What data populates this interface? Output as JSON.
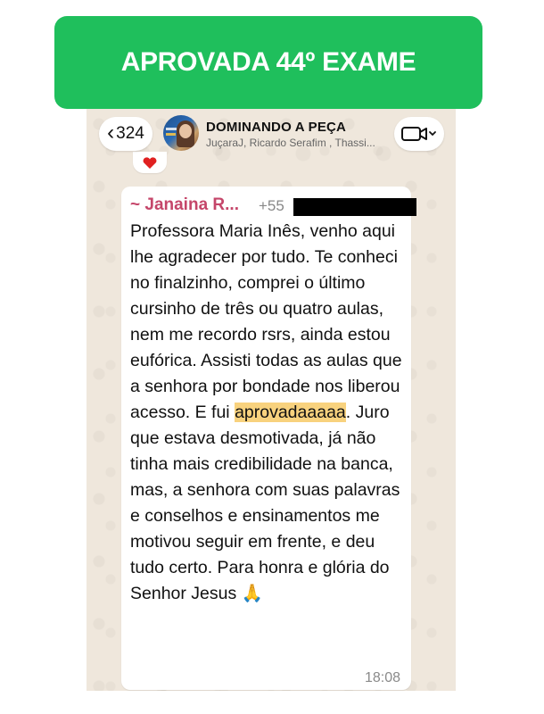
{
  "banner": {
    "text": "APROVADA 44º EXAME"
  },
  "header": {
    "back_count": "324",
    "group_title": "DOMINANDO A PEÇA",
    "group_members": "JuçaraJ, Ricardo Serafim , Thassi..."
  },
  "reaction": {
    "emoji": "heart"
  },
  "message": {
    "sender_name": "~ Janaina R...",
    "sender_phone": "+55",
    "text_before": "Professora Maria Inês, venho aqui lhe agradecer por tudo. Te conheci no finalzinho, comprei o último cursinho de três ou quatro aulas, nem me recordo rsrs, ainda estou eufórica. Assisti todas as aulas que a senhora por bondade nos liberou acesso. E fui ",
    "text_highlight": "aprovadaaaaa",
    "text_after": ". Juro que estava desmotivada, já não tinha mais credibilidade na banca, mas, a senhora com suas palavras e conselhos e ensinamentos me motivou seguir em frente, e deu tudo certo. Para honra e glória do Senhor Jesus 🙏",
    "time": "18:08"
  },
  "colors": {
    "banner_bg": "#1fbf5c",
    "sender_name": "#c5466a",
    "highlight": "#f8d27e",
    "chat_bg": "#efe7dc"
  }
}
